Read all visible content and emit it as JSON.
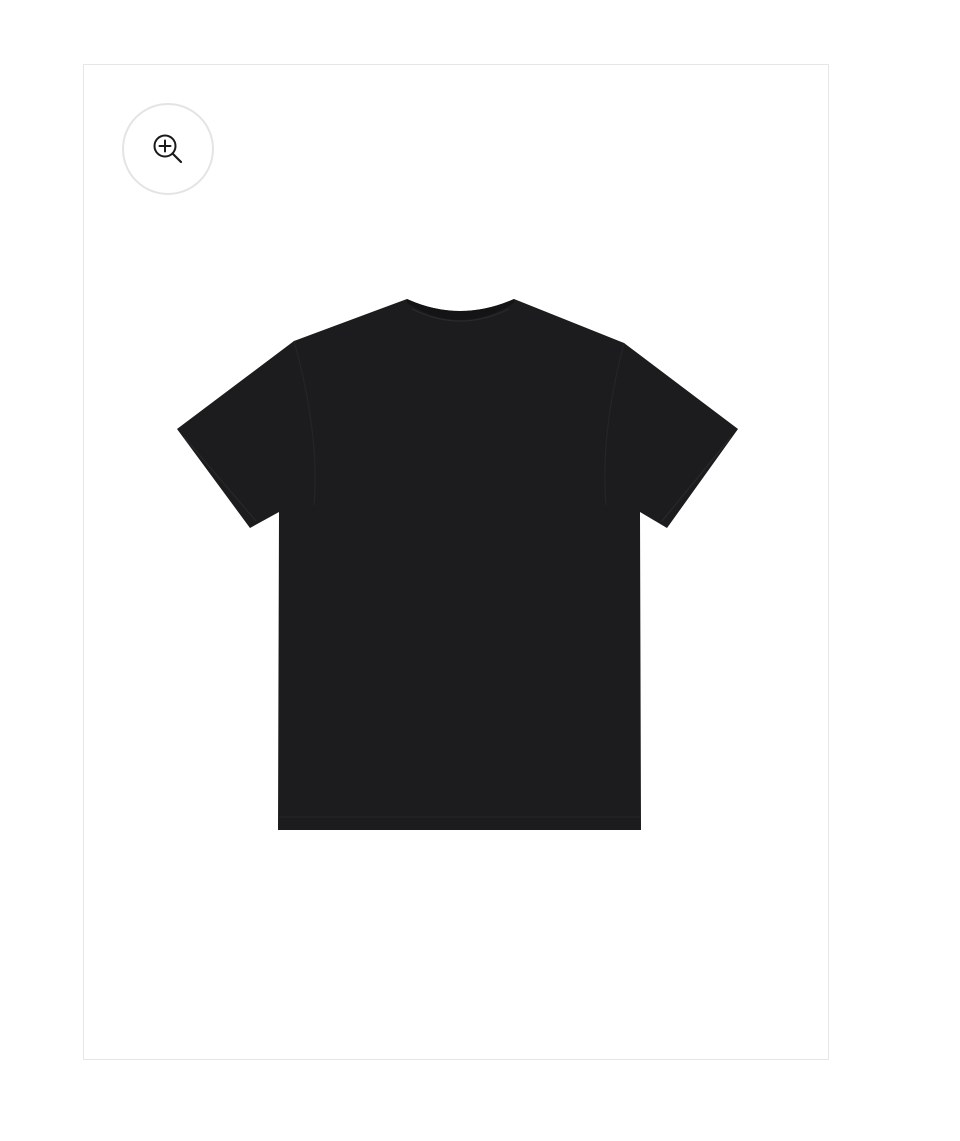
{
  "product_gallery": {
    "zoom_button": {
      "icon": "zoom-in-icon"
    },
    "main_image": {
      "subject": "black-tshirt",
      "colors": {
        "garment": "#1c1c1e",
        "garment_shadow": "#141416",
        "stitch": "#2a2a2d"
      }
    },
    "colors": {
      "frame_border": "#e6e6e6",
      "background": "#ffffff",
      "icon_stroke": "#1a1a1a"
    }
  }
}
